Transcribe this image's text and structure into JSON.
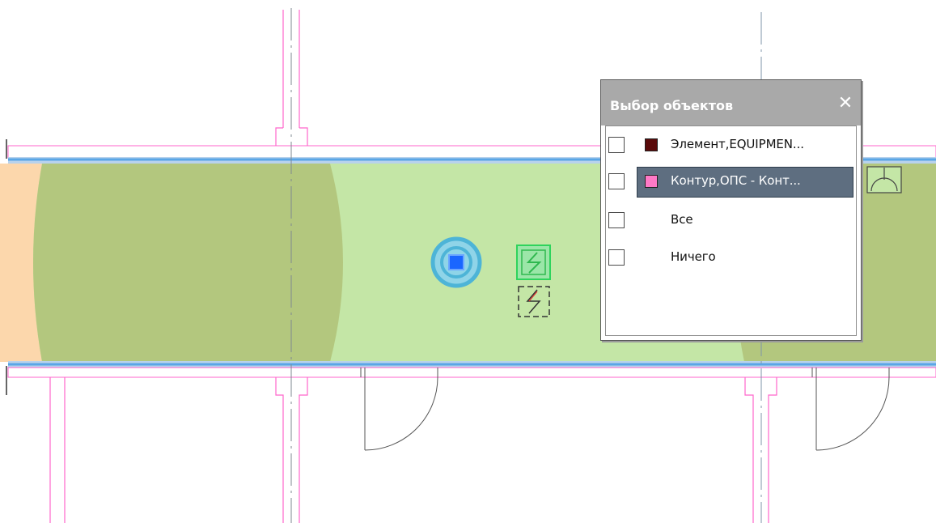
{
  "dialog": {
    "title": "Выбор объектов",
    "close_symbol": "✕",
    "options": [
      {
        "label": "Элемент,EQUIPMEN...",
        "color": "#5a0a0a",
        "checked": false,
        "selected": false
      },
      {
        "label": "Контур,ОПС - Конт...",
        "color": "#ff79c6",
        "checked": false,
        "selected": true
      },
      {
        "label": "Все",
        "checked": false,
        "selected": false
      },
      {
        "label": "Ничего",
        "checked": false,
        "selected": false
      }
    ]
  },
  "colors": {
    "wall_line": "#ff66cc",
    "wall_fill": "#b8d2ec",
    "corridor_fill": "#c4e6a6",
    "coverage_zone": "#b3c77e",
    "peach_zone": "#fcd7ac",
    "detector": "#57b9d8",
    "device_green": "#2fd35c"
  },
  "icons": [
    "smoke-detector-icon",
    "fire-alarm-panel-icon",
    "power-symbol-icon",
    "door-swing-icon",
    "sounder-icon",
    "close-icon"
  ]
}
